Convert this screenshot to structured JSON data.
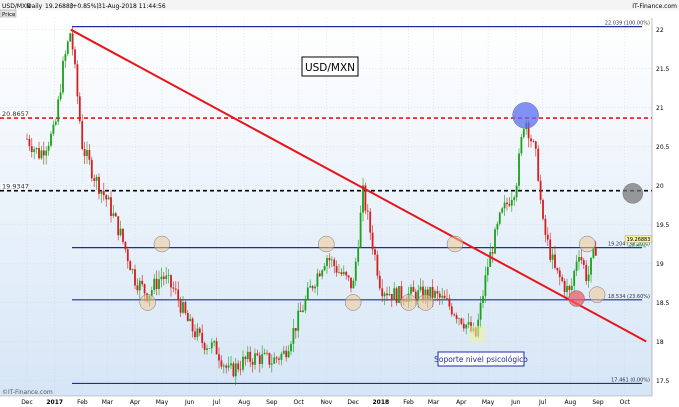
{
  "header": {
    "symbol": "USD/MXN",
    "interval": "Daily",
    "last": "19.26883",
    "change": "(+0.85%)",
    "datetime": "31-Aug-2018 11:44:56",
    "source": "IT-Finance.com",
    "price_tab": "Price"
  },
  "watermark": "©IT-Finance.com",
  "chart_data": {
    "type": "line",
    "title": "USD/MXN",
    "ylim": [
      17.3,
      22.15
    ],
    "y_ticks": [
      "22",
      "21.5",
      "21",
      "20.5",
      "20",
      "19.5",
      "19",
      "18.5",
      "18",
      "17.5"
    ],
    "x_ticks": [
      "Dec",
      "2017",
      "Feb",
      "Mar",
      "Apr",
      "May",
      "Jun",
      "Jul",
      "Aug",
      "Sep",
      "Oct",
      "Nov",
      "Dec",
      "2018",
      "Feb",
      "Mar",
      "Apr",
      "May",
      "Jun",
      "Jul",
      "Aug",
      "Sep",
      "Oct"
    ],
    "series": [
      {
        "x": [
          "2016-12-01",
          "2016-12-15",
          "2017-01-01",
          "2017-01-10",
          "2017-01-19",
          "2017-02-01",
          "2017-02-15",
          "2017-03-01",
          "2017-03-15",
          "2017-04-01",
          "2017-04-15",
          "2017-05-01",
          "2017-05-15",
          "2017-06-01",
          "2017-06-15",
          "2017-07-01",
          "2017-07-15",
          "2017-08-01",
          "2017-08-15",
          "2017-09-01",
          "2017-09-15",
          "2017-10-01",
          "2017-10-15",
          "2017-11-01",
          "2017-11-15",
          "2017-12-01",
          "2017-12-12",
          "2018-01-01",
          "2018-01-15",
          "2018-02-01",
          "2018-02-15",
          "2018-03-01",
          "2018-03-15",
          "2018-04-01",
          "2018-04-17",
          "2018-05-01",
          "2018-05-15",
          "2018-06-01",
          "2018-06-11",
          "2018-06-25",
          "2018-07-01",
          "2018-07-15",
          "2018-08-01",
          "2018-08-10",
          "2018-08-20",
          "2018-08-31"
        ],
        "values": [
          20.6,
          20.4,
          20.7,
          21.5,
          22.0,
          20.5,
          20.1,
          19.8,
          19.4,
          18.8,
          18.6,
          18.85,
          18.65,
          18.2,
          18.0,
          17.9,
          17.6,
          17.75,
          17.8,
          17.75,
          17.85,
          18.3,
          18.7,
          19.1,
          18.9,
          18.7,
          19.9,
          18.7,
          18.6,
          18.6,
          18.6,
          18.6,
          18.5,
          18.3,
          18.05,
          19.0,
          19.6,
          20.0,
          20.9,
          20.3,
          19.5,
          18.9,
          18.6,
          19.2,
          18.8,
          19.27
        ]
      }
    ],
    "trendline": {
      "from": {
        "x": "2017-01-19",
        "y": 22.0
      },
      "to": {
        "x": "2018-10-25",
        "y": 18.0
      }
    },
    "horizontal_levels": [
      {
        "y": 22.039,
        "label": "22.039 (100.00%)",
        "style": "solid",
        "color": "#1f2aa8"
      },
      {
        "y": 20.8657,
        "label": "20.8657",
        "style": "dashed",
        "color": "#e8141a"
      },
      {
        "y": 19.9347,
        "label": "19.9347",
        "style": "dashed",
        "color": "#000000"
      },
      {
        "y": 19.204,
        "label": "19.204 (38.20%)",
        "style": "solid",
        "color": "#1f2aa8"
      },
      {
        "y": 18.534,
        "label": "18.534 (23.60%)",
        "style": "solid",
        "color": "#1f2aa8"
      },
      {
        "y": 17.461,
        "label": "17.461 (0.00%)",
        "style": "solid",
        "color": "#1f2aa8"
      }
    ],
    "price_marker": {
      "y": 19.26883,
      "value": "19.26883",
      "change": "+0.85%"
    },
    "annotations": {
      "title_box": "USD/MXN",
      "support_box": "Soporte nivel psicológico"
    },
    "colors": {
      "up": "#1aa01a",
      "down": "#d51e1e",
      "level": "#1f2aa8",
      "trendline": "#e8141a",
      "plot_bg_top": "#ffffff",
      "plot_bg_bottom": "#d6e6f6"
    }
  }
}
